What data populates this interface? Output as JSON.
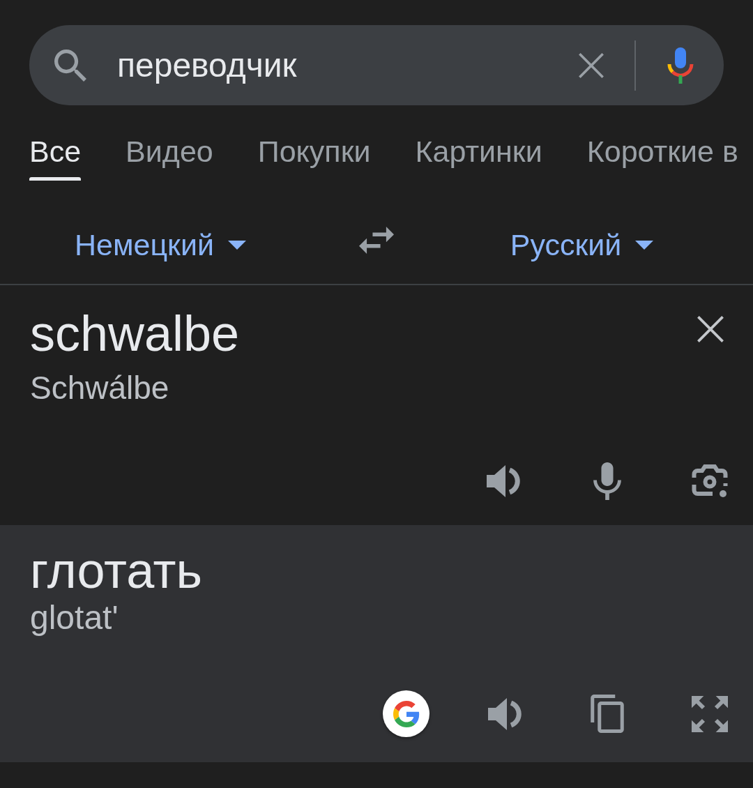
{
  "search": {
    "value": "переводчик"
  },
  "tabs": [
    {
      "label": "Все",
      "selected": true
    },
    {
      "label": "Видео",
      "selected": false
    },
    {
      "label": "Покупки",
      "selected": false
    },
    {
      "label": "Картинки",
      "selected": false
    },
    {
      "label": "Короткие в",
      "selected": false
    }
  ],
  "languages": {
    "source": "Немецкий",
    "target": "Русский"
  },
  "source": {
    "text": "schwalbe",
    "transliteration": "Schwálbe"
  },
  "translation": {
    "text": "глотать",
    "transliteration": "glotat'"
  }
}
